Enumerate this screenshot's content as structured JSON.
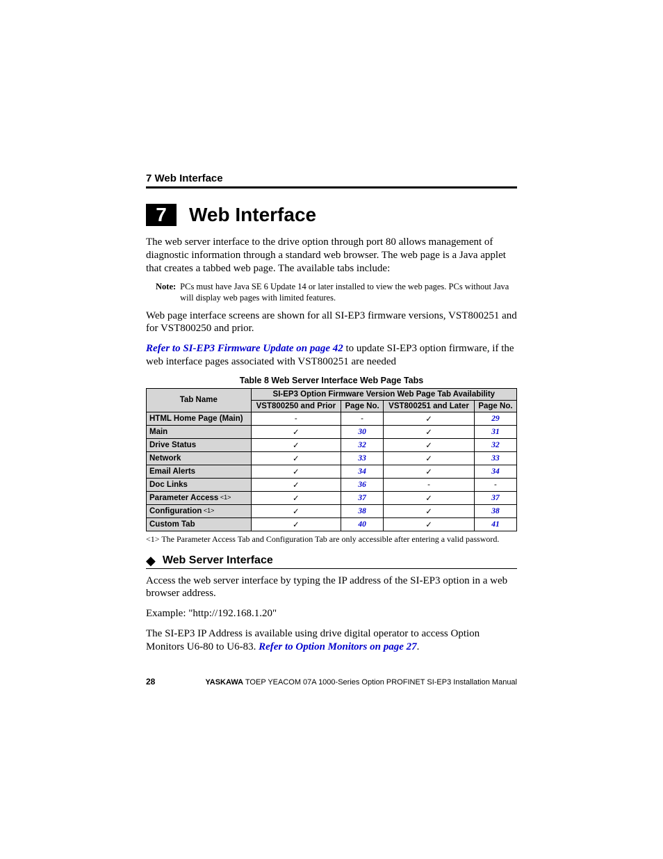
{
  "running_head": "7  Web Interface",
  "section_number": "7",
  "section_title": "Web Interface",
  "intro_para": "The web server interface to the drive option through port 80 allows management of diagnostic information through a standard web browser. The web page is a Java applet that creates a tabbed web page. The available tabs include:",
  "note": {
    "label": "Note:",
    "text": "PCs must have Java SE 6 Update 14 or later installed to view the web pages. PCs without Java will display web pages with limited features."
  },
  "para2": "Web page interface screens are shown for all SI-EP3 firmware versions, VST800251 and for VST800250 and prior.",
  "para3_link": "Refer to SI-EP3 Firmware Update on page 42",
  "para3_rest": " to update SI-EP3 option firmware, if the web interface pages associated with VST800251 are needed",
  "table_caption": "Table 8  Web Server Interface Web Page Tabs",
  "table": {
    "head_tab_name": "Tab Name",
    "head_group": "SI-EP3 Option Firmware Version Web Page Tab Availability",
    "head_col1": "VST800250 and Prior",
    "head_col2": "Page No.",
    "head_col3": "VST800251 and Later",
    "head_col4": "Page No.",
    "rows": [
      {
        "name": "HTML Home Page (Main)",
        "sup": "",
        "c1": "-",
        "c2": "-",
        "c3": "✓",
        "c4": "29"
      },
      {
        "name": "Main",
        "sup": "",
        "c1": "✓",
        "c2": "30",
        "c3": "✓",
        "c4": "31"
      },
      {
        "name": "Drive Status",
        "sup": "",
        "c1": "✓",
        "c2": "32",
        "c3": "✓",
        "c4": "32"
      },
      {
        "name": "Network",
        "sup": "",
        "c1": "✓",
        "c2": "33",
        "c3": "✓",
        "c4": "33"
      },
      {
        "name": "Email Alerts",
        "sup": "",
        "c1": "✓",
        "c2": "34",
        "c3": "✓",
        "c4": "34"
      },
      {
        "name": "Doc Links",
        "sup": "",
        "c1": "✓",
        "c2": "36",
        "c3": "-",
        "c4": "-"
      },
      {
        "name": "Parameter Access",
        "sup": "<1>",
        "c1": "✓",
        "c2": "37",
        "c3": "✓",
        "c4": "37"
      },
      {
        "name": "Configuration",
        "sup": "<1>",
        "c1": "✓",
        "c2": "38",
        "c3": "✓",
        "c4": "38"
      },
      {
        "name": "Custom Tab",
        "sup": "",
        "c1": "✓",
        "c2": "40",
        "c3": "✓",
        "c4": "41"
      }
    ]
  },
  "table_footnote": "<1> The Parameter Access Tab and Configuration Tab are only accessible after entering a valid password.",
  "sub_heading": "Web Server Interface",
  "sub_para1": "Access the web server interface by typing the IP address of the SI-EP3 option in a web browser address.",
  "sub_para2": "Example: \"http://192.168.1.20\"",
  "sub_para3_a": "The SI-EP3 IP Address is available using drive digital operator to access Option Monitors U6-80 to U6-83. ",
  "sub_para3_link": "Refer to Option Monitors on page 27",
  "sub_para3_b": ".",
  "footer": {
    "page_no": "28",
    "brand": "YASKAWA",
    "doc": " TOEP YEACOM 07A 1000-Series Option PROFINET SI-EP3 Installation Manual"
  }
}
